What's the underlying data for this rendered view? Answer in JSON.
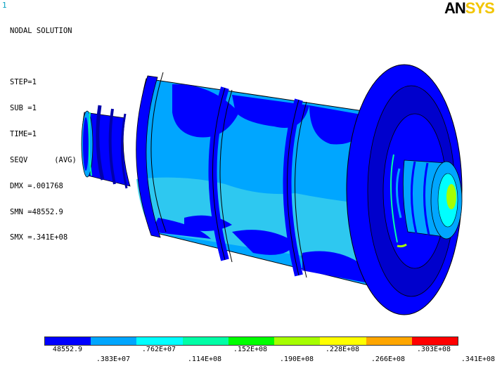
{
  "window_id": "1",
  "logo": {
    "part1": "AN",
    "part2": "SYS",
    "color_part1": "#000000",
    "color_part2": "#f2c500"
  },
  "info": {
    "title": "NODAL SOLUTION",
    "step": "STEP=1",
    "sub": "SUB =1",
    "time": "TIME=1",
    "result": "SEQV      (AVG)",
    "dmx": "DMX =.001768",
    "smn": "SMN =48552.9",
    "smx": "SMX =.341E+08"
  },
  "legend": {
    "colors": [
      "#0000ff",
      "#00a6ff",
      "#00ffff",
      "#00ffa6",
      "#00ff00",
      "#a6ff00",
      "#ffff00",
      "#ffa600",
      "#ff0000"
    ],
    "labels_top": [
      "48552.9",
      ".762E+07",
      ".152E+08",
      ".228E+08",
      ".303E+08"
    ],
    "labels_bottom": [
      ".383E+07",
      ".114E+08",
      ".190E+08",
      ".266E+08",
      ".341E+08"
    ]
  }
}
